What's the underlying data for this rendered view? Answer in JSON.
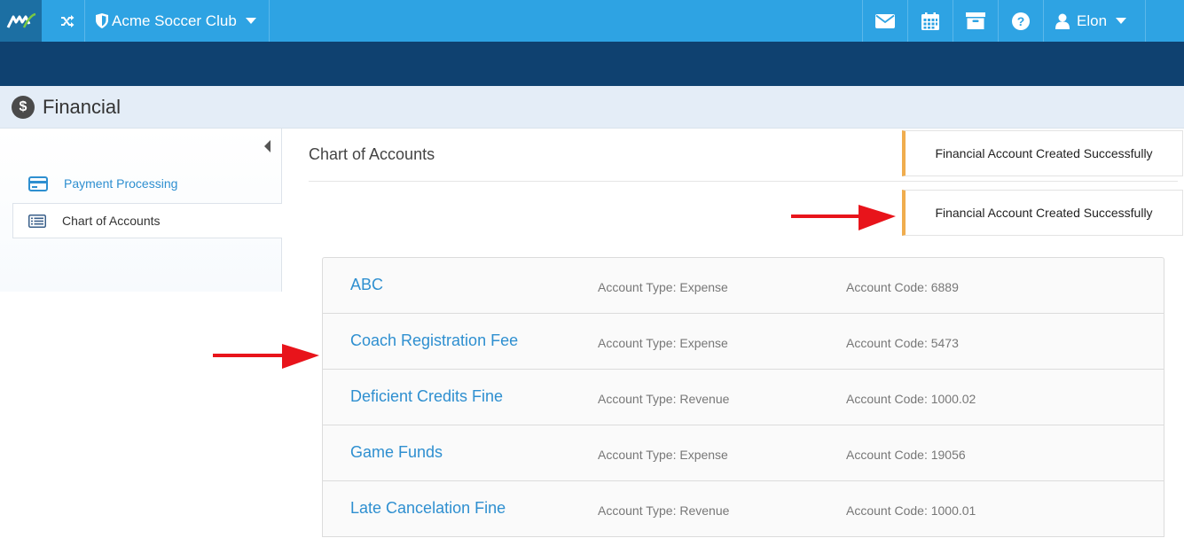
{
  "topbar": {
    "club_name": "Acme Soccer Club",
    "user_name": "Elon"
  },
  "page": {
    "title": "Financial"
  },
  "sidebar": {
    "items": [
      {
        "label": "Payment Processing"
      },
      {
        "label": "Chart of Accounts"
      }
    ]
  },
  "main": {
    "section_title": "Chart of Accounts",
    "toasts": [
      {
        "message": "Financial Account Created Successfully"
      },
      {
        "message": "Financial Account Created Successfully"
      }
    ],
    "accounts": [
      {
        "name": "ABC",
        "type": "Account Type: Expense",
        "code": "Account Code: 6889"
      },
      {
        "name": "Coach Registration Fee",
        "type": "Account Type: Expense",
        "code": "Account Code: 5473"
      },
      {
        "name": "Deficient Credits Fine",
        "type": "Account Type: Revenue",
        "code": "Account Code: 1000.02"
      },
      {
        "name": "Game Funds",
        "type": "Account Type: Expense",
        "code": "Account Code: 19056"
      },
      {
        "name": "Late Cancelation Fine",
        "type": "Account Type: Revenue",
        "code": "Account Code: 1000.01"
      }
    ]
  },
  "icons": {
    "logo": "app-logo-icon",
    "switch": "shuffle-icon",
    "club": "shield-icon",
    "mail": "envelope-icon",
    "calendar": "calendar-icon",
    "archive": "archive-icon",
    "help": "question-icon",
    "user": "user-icon"
  },
  "colors": {
    "topbar": "#2ea3e3",
    "darkbar": "#0f4170",
    "header_bg": "#e4edf7",
    "link": "#2e8fd0",
    "toast_accent": "#f0ad4e",
    "annotation_arrow": "#e8141b"
  }
}
